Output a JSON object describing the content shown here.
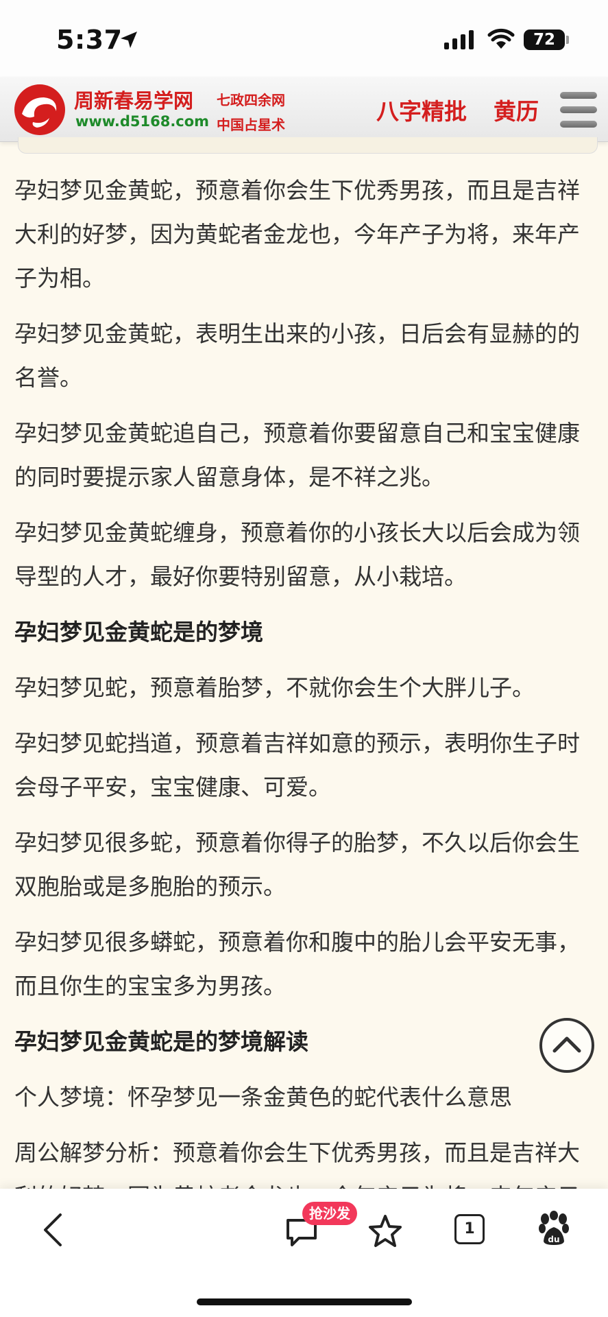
{
  "status": {
    "time": "5:37",
    "battery": "72"
  },
  "header": {
    "site_name": "周新春易学网",
    "site_url": "www.d5168.com",
    "tagline_top": "七政四余网",
    "tagline_bottom": "中国占星术",
    "nav": [
      "八字精批",
      "黄历"
    ]
  },
  "article": {
    "blocks": [
      "孕妇梦见金黄蛇，预意着你会生下优秀男孩，而且是吉祥大利的好梦，因为黄蛇者金龙也，今年产子为将，来年产子为相。",
      "孕妇梦见金黄蛇，表明生出来的小孩，日后会有显赫的的名誉。",
      "孕妇梦见金黄蛇追自己，预意着你要留意自己和宝宝健康的同时要提示家人留意身体，是不祥之兆。",
      "孕妇梦见金黄蛇缠身，预意着你的小孩长大以后会成为领导型的人才，最好你要特别留意，从小栽培。",
      "孕妇梦见金黄蛇是的梦境",
      "孕妇梦见蛇，预意着胎梦，不就你会生个大胖儿子。",
      "孕妇梦见蛇挡道，预意着吉祥如意的预示，表明你生子时会母子平安，宝宝健康、可爱。",
      "孕妇梦见很多蛇，预意着你得子的胎梦，不久以后你会生双胞胎或是多胞胎的预示。",
      "孕妇梦见很多蟒蛇，预意着你和腹中的胎儿会平安无事，而且你生的宝宝多为男孩。",
      "孕妇梦见金黄蛇是的梦境解读",
      "个人梦境：怀孕梦见一条金黄色的蛇代表什么意思",
      "周公解梦分析：预意着你会生下优秀男孩，而且是吉祥大利的好梦，因为黄蛇者金龙也，今年产子为将，来年产子为相。"
    ]
  },
  "toolbar": {
    "comment_badge": "抢沙发",
    "tab_count": "1"
  },
  "colors": {
    "brand_red": "#d41e1e",
    "url_green": "#1e8a2a",
    "page_bg": "#fdf9ee",
    "badge": "#f2385a"
  },
  "icons": [
    "location-arrow-icon",
    "signal-icon",
    "wifi-icon",
    "battery-icon",
    "menu-icon",
    "scroll-top-icon",
    "back-icon",
    "comment-icon",
    "star-icon",
    "tabs-icon",
    "baidu-paw-icon"
  ]
}
